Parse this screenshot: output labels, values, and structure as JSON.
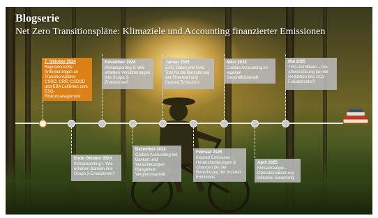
{
  "header": {
    "title": "Blogserie",
    "subtitle": "Net Zero Transitionspläne: Klimaziele und Accounting finanzierter Emissionen"
  },
  "events_top": [
    {
      "date": "7. Oktober 2024",
      "text": "Regulatorische Anforderungen an Transitionspläne: CSRD, CRR, CSDDD und EBA Leitlinien zum ESG-Risikomanagement"
    },
    {
      "date": "November 2024",
      "text": "Klimareporting II: Wie erheben Versicherungen ihre Scope 3-Emissionen?"
    },
    {
      "date": "Januar 2025",
      "text": "ESG-Daten und PwC Tool für die Berechnung der Financed und Insured Emissions"
    },
    {
      "date": "März 2025",
      "text": "Carbon Accounting im eigenen Geschäftsbetrieb"
    },
    {
      "date": "Mai 2025",
      "text": "THG-Zertifikate – Die Allwecklösung bei der Reduktion des CO2 Fußabdrucks?"
    }
  ],
  "events_bottom": [
    {
      "date": "Ende Oktober 2024",
      "text": "Klimareporting I: Wie erheben Banken ihre Scope 3-Emissionen?"
    },
    {
      "date": "Dezember 2024",
      "text": "Carbon Accounting bei Banken und Versicherungen: Mangelnde Vergleichbarkeit"
    },
    {
      "date": "Februar 2025",
      "text": "Insured Emissions - Herausforderungen & Chancen bei der Berechnung der Insured Emissions"
    },
    {
      "date": "April 2025",
      "text": "Klimastrategie – Operationalisierung inklusive Steuerung"
    }
  ],
  "colors": {
    "accent": "#e2831a",
    "card": "#b9b9b9",
    "line": "#e8e8e8"
  },
  "icons": [
    "stack-of-books-icon",
    "cyclist-silhouette"
  ]
}
